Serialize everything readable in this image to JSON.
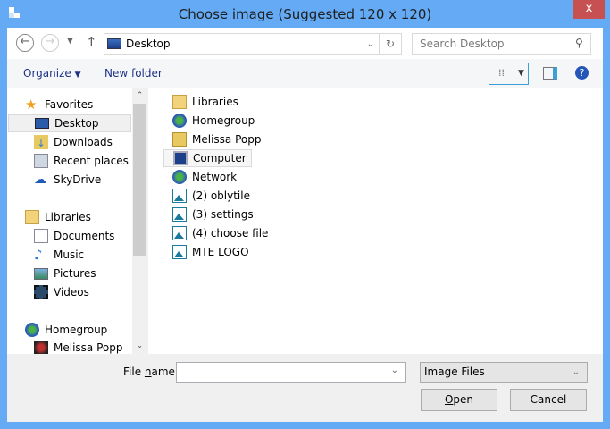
{
  "window": {
    "title": "Choose image (Suggested 120 x 120)",
    "close": "x"
  },
  "nav": {
    "address": "Desktop",
    "search_placeholder": "Search Desktop"
  },
  "toolbar": {
    "organize": "Organize",
    "new_folder": "New folder"
  },
  "sidebar": {
    "groups": [
      {
        "label": "Favorites",
        "items": [
          "Desktop",
          "Downloads",
          "Recent places",
          "SkyDrive"
        ]
      },
      {
        "label": "Libraries",
        "items": [
          "Documents",
          "Music",
          "Pictures",
          "Videos"
        ]
      },
      {
        "label": "Homegroup",
        "items": [
          "Melissa Popp"
        ]
      }
    ],
    "selected": "Desktop"
  },
  "files": [
    {
      "name": "Libraries",
      "icon": "libraries-icon"
    },
    {
      "name": "Homegroup",
      "icon": "homegroup-icon"
    },
    {
      "name": "Melissa Popp",
      "icon": "user-folder-icon"
    },
    {
      "name": "Computer",
      "icon": "computer-icon"
    },
    {
      "name": "Network",
      "icon": "network-icon"
    },
    {
      "name": "(2) oblytile",
      "icon": "image-icon"
    },
    {
      "name": "(3) settings",
      "icon": "image-icon"
    },
    {
      "name": "(4) choose file",
      "icon": "image-icon"
    },
    {
      "name": "MTE LOGO",
      "icon": "image-icon"
    }
  ],
  "bottom": {
    "file_name_label_pre": "File ",
    "file_name_label_u": "n",
    "file_name_label_post": "ame:",
    "file_name_value": "",
    "file_type": "Image Files",
    "open_u": "O",
    "open_rest": "pen",
    "cancel": "Cancel"
  }
}
